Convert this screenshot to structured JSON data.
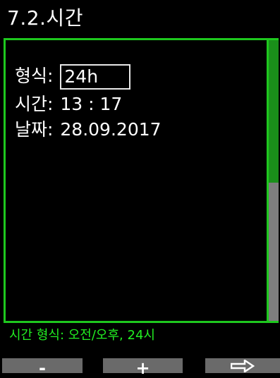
{
  "screen": {
    "title": "7.2.시간"
  },
  "settings": {
    "format_label": "형식:",
    "format_value": "24h",
    "time_label": "시간:",
    "time_value": "13 : 17",
    "date_label": "날짜:",
    "date_value": "28.09.2017"
  },
  "help": {
    "text": "시간 형식: 오전/오후, 24시"
  },
  "softkeys": {
    "minus_label": "-",
    "plus_label": "+",
    "next_icon": "arrow-right-icon"
  },
  "colors": {
    "accent_green": "#1ec81e",
    "help_text_green": "#22ee22",
    "scroll_thumb_green": "#1a8f1a",
    "scroll_track_gray": "#7e7e7e",
    "softkey_gray": "#6a6a6a"
  }
}
